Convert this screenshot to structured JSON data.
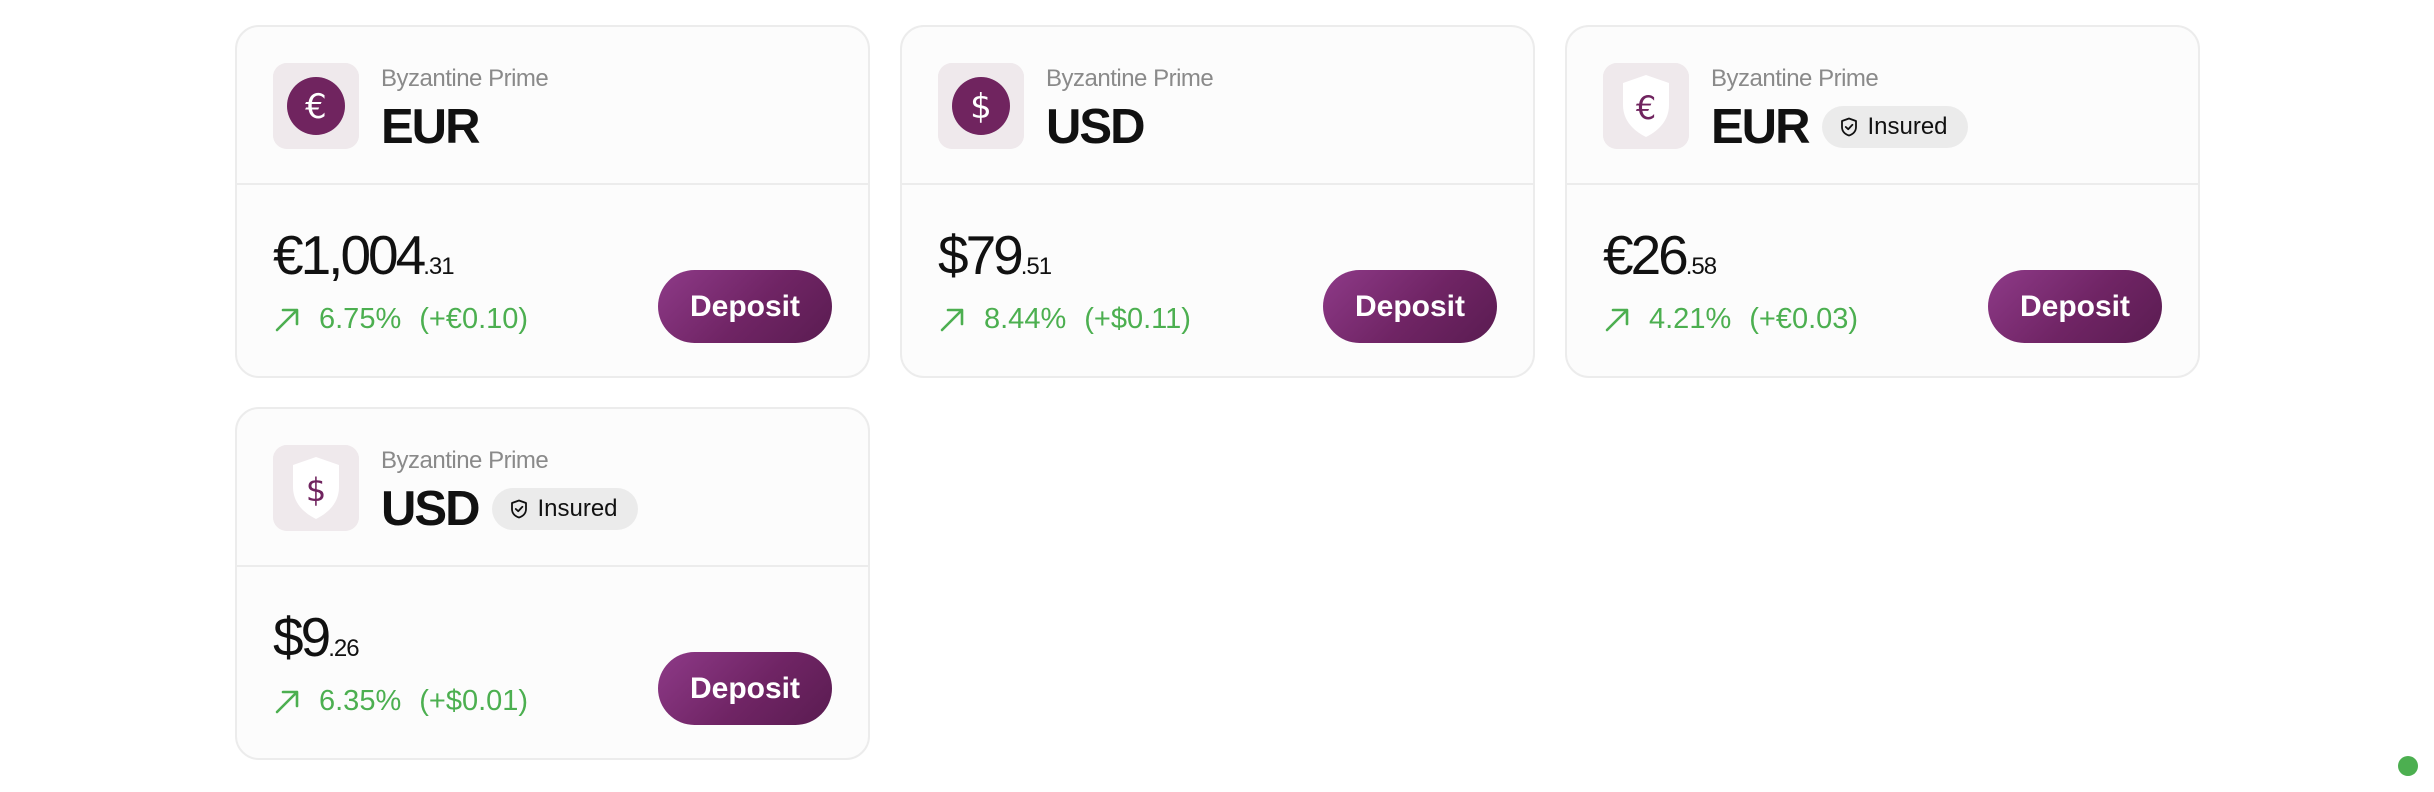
{
  "colors": {
    "brand": "#70245f",
    "positive": "#4caf50",
    "badge_bg": "#ebebeb"
  },
  "accounts": [
    {
      "provider": "Byzantine Prime",
      "currency": "EUR",
      "symbol": "€",
      "icon": "euro-coin-icon",
      "insured": false,
      "insured_label": "",
      "balance_main": "€1,004",
      "balance_cents": ".31",
      "change_pct": "6.75%",
      "change_abs": "(+€0.10)",
      "deposit_label": "Deposit"
    },
    {
      "provider": "Byzantine Prime",
      "currency": "USD",
      "symbol": "$",
      "icon": "dollar-coin-icon",
      "insured": false,
      "insured_label": "",
      "balance_main": "$79",
      "balance_cents": ".51",
      "change_pct": "8.44%",
      "change_abs": "(+$0.11)",
      "deposit_label": "Deposit"
    },
    {
      "provider": "Byzantine Prime",
      "currency": "EUR",
      "symbol": "€",
      "icon": "euro-shield-icon",
      "insured": true,
      "insured_label": "Insured",
      "balance_main": "€26",
      "balance_cents": ".58",
      "change_pct": "4.21%",
      "change_abs": "(+€0.03)",
      "deposit_label": "Deposit"
    },
    {
      "provider": "Byzantine Prime",
      "currency": "USD",
      "symbol": "$",
      "icon": "dollar-shield-icon",
      "insured": true,
      "insured_label": "Insured",
      "balance_main": "$9",
      "balance_cents": ".26",
      "change_pct": "6.35%",
      "change_abs": "(+$0.01)",
      "deposit_label": "Deposit"
    }
  ]
}
